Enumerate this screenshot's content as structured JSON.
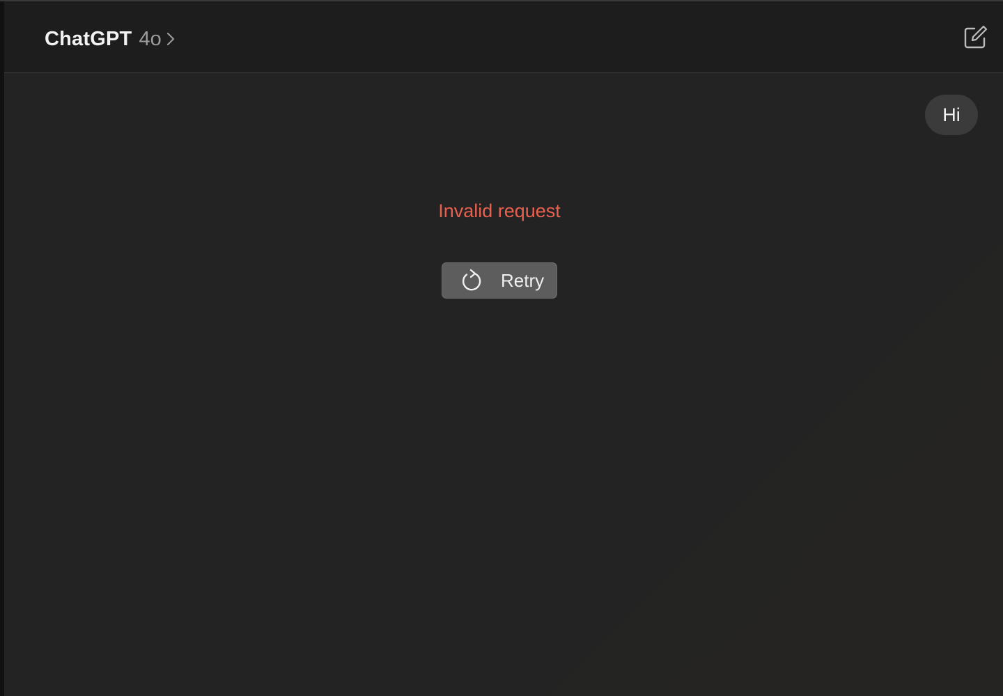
{
  "header": {
    "app_name": "ChatGPT",
    "model": "4o",
    "icons": {
      "model_chevron": "chevron-right-icon",
      "new_chat": "new-chat-icon"
    }
  },
  "conversation": {
    "user_message": "Hi",
    "error_message": "Invalid request",
    "retry_label": "Retry"
  },
  "colors": {
    "background": "#232323",
    "header_background": "#1d1d1d",
    "error_text": "#e8604e",
    "retry_button": "#5d5d5d",
    "user_bubble": "#3b3b3b"
  }
}
